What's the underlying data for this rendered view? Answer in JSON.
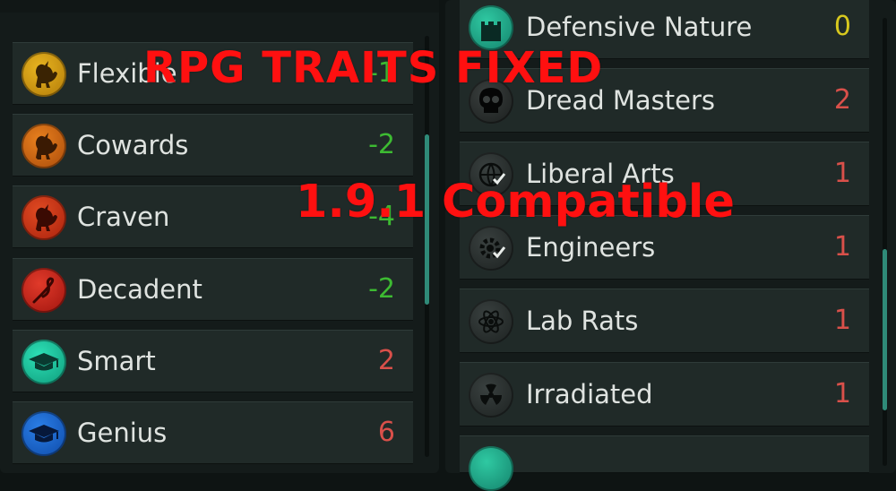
{
  "colors": {
    "positive": "#3dbb32",
    "negative": "#d9504a",
    "neutral": "#d7c81e",
    "overlay": "#ff1010",
    "scrollbar": "#2f8a78"
  },
  "overlay": {
    "title": "RPG TRAITS FIXED",
    "subtitle": "1.9.1 Compatible"
  },
  "left_list": {
    "items": [
      {
        "label": "Flexible",
        "value": "-1",
        "icon": "rooster-icon",
        "tone": "positive"
      },
      {
        "label": "Cowards",
        "value": "-2",
        "icon": "rooster-icon",
        "tone": "positive"
      },
      {
        "label": "Craven",
        "value": "-4",
        "icon": "rooster-icon",
        "tone": "positive"
      },
      {
        "label": "Decadent",
        "value": "-2",
        "icon": "whip-icon",
        "tone": "positive"
      },
      {
        "label": "Smart",
        "value": "2",
        "icon": "graduation-cap-icon",
        "tone": "negative"
      },
      {
        "label": "Genius",
        "value": "6",
        "icon": "graduation-cap-icon",
        "tone": "negative"
      }
    ],
    "scroll_position": 0.45
  },
  "right_list": {
    "items": [
      {
        "label": "Defensive Nature",
        "value": "0",
        "icon": "castle-icon",
        "tone": "neutral"
      },
      {
        "label": "Dread Masters",
        "value": "2",
        "icon": "skull-icon",
        "tone": "negative"
      },
      {
        "label": "Liberal Arts",
        "value": "1",
        "icon": "globe-check-icon",
        "tone": "negative"
      },
      {
        "label": "Engineers",
        "value": "1",
        "icon": "gear-check-icon",
        "tone": "negative"
      },
      {
        "label": "Lab Rats",
        "value": "1",
        "icon": "atom-icon",
        "tone": "negative"
      },
      {
        "label": "Irradiated",
        "value": "1",
        "icon": "radiation-icon",
        "tone": "negative"
      }
    ],
    "scroll_position": 0.7
  }
}
